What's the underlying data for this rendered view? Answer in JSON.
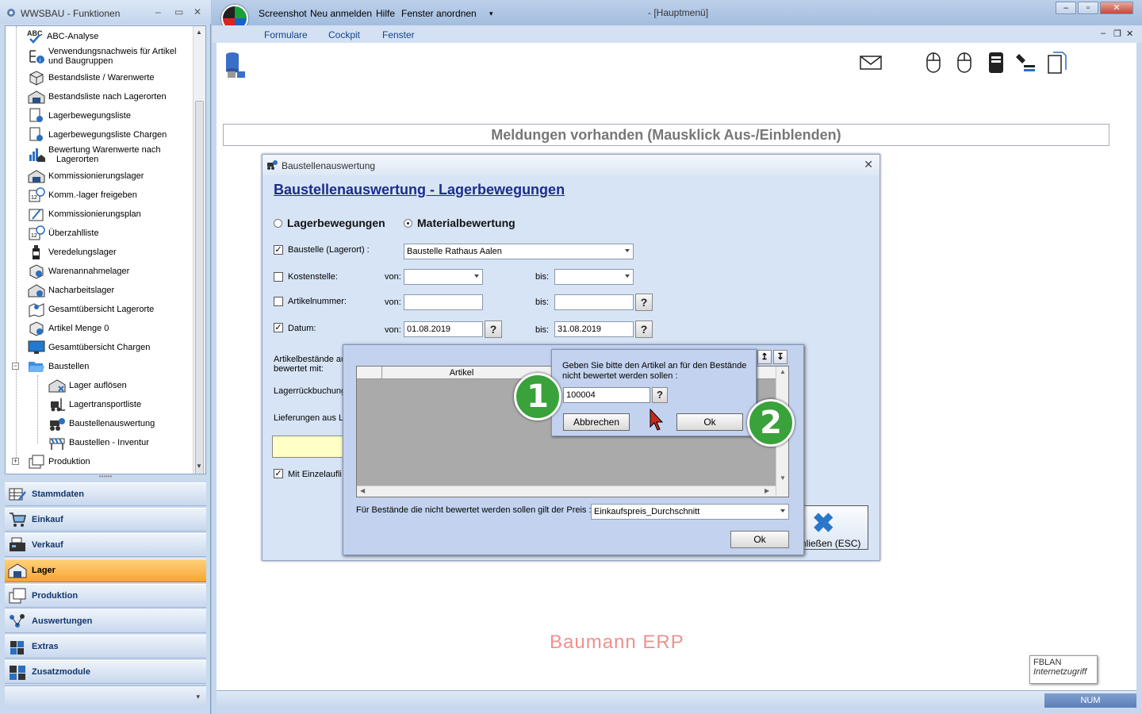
{
  "left_window": {
    "title": "WWSBAU - Funktionen",
    "tree_items": [
      {
        "label": "ABC-Analyse",
        "icon": "abc-check-icon"
      },
      {
        "label": "Verwendungsnachweis für Artikel",
        "label2": "und Baugruppen",
        "icon": "structure-info-icon"
      },
      {
        "label": "Bestandsliste / Warenwerte",
        "icon": "box-icon"
      },
      {
        "label": "Bestandsliste nach Lagerorten",
        "icon": "warehouse-icon"
      },
      {
        "label": "Lagerbewegungsliste",
        "icon": "document-gear-icon"
      },
      {
        "label": "Lagerbewegungsliste Chargen",
        "icon": "document-gear-icon"
      },
      {
        "label": "Bewertung Warenwerte nach",
        "label2": "Lagerorten",
        "icon": "chart-warehouse-icon"
      },
      {
        "label": "Kommissionierungslager",
        "icon": "warehouse-icon"
      },
      {
        "label": "Komm.-lager freigeben",
        "icon": "calendar-clock-icon"
      },
      {
        "label": "Kommissionierungsplan",
        "icon": "pencil-board-icon"
      },
      {
        "label": "Überzahlliste",
        "icon": "calendar-clock-icon"
      },
      {
        "label": "Veredelungslager",
        "icon": "bottle-icon"
      },
      {
        "label": "Warenannahmelager",
        "icon": "box-gear-icon"
      },
      {
        "label": "Nacharbeitslager",
        "icon": "warehouse-gear-icon"
      },
      {
        "label": "Gesamtübersicht Lagerorte",
        "icon": "map-pin-icon"
      },
      {
        "label": "Artikel Menge 0",
        "icon": "box-info-icon"
      },
      {
        "label": "Gesamtübersicht Chargen",
        "icon": "monitor-icon"
      },
      {
        "label": "Baustellen",
        "icon": "folder-open-icon"
      },
      {
        "label": "Lager auflösen",
        "icon": "warehouse-x-icon"
      },
      {
        "label": "Lagertransportliste",
        "icon": "forklift-icon"
      },
      {
        "label": "Baustellenauswertung",
        "icon": "vehicle-gear-icon"
      },
      {
        "label": "Baustellen - Inventur",
        "icon": "barrier-icon"
      },
      {
        "label": "Produktion",
        "icon": "machine-icon"
      }
    ],
    "nav_buttons": [
      {
        "label": "Stammdaten",
        "icon": "table-edit-icon",
        "active": false
      },
      {
        "label": "Einkauf",
        "icon": "shopping-cart-icon",
        "active": false
      },
      {
        "label": "Verkauf",
        "icon": "cash-register-icon",
        "active": false
      },
      {
        "label": "Lager",
        "icon": "warehouse-icon",
        "active": true
      },
      {
        "label": "Produktion",
        "icon": "machine-icon",
        "active": false
      },
      {
        "label": "Auswertungen",
        "icon": "network-icon",
        "active": false
      },
      {
        "label": "Extras",
        "icon": "puzzle-icon",
        "active": false
      },
      {
        "label": "Zusatzmodule",
        "icon": "modules-icon",
        "active": false
      }
    ]
  },
  "main_window": {
    "quick_access": [
      "Screenshot",
      "Neu anmelden",
      "Hilfe",
      "Fenster anordnen"
    ],
    "caption": "- [Hauptmenü]",
    "ribbon_tabs": [
      "Formulare",
      "Cockpit",
      "Fenster"
    ],
    "messages_bar": "Meldungen vorhanden  (Mausklick Aus-/Einblenden)",
    "watermark": "Baumann ERP",
    "tooltip": {
      "line1": "FBLAN",
      "line2": "Internetzugriff"
    },
    "status_num": "NUM"
  },
  "dialog": {
    "title": "Baustellenauswertung",
    "heading": "Baustellenauswertung - Lagerbewegungen",
    "radio_options": [
      {
        "label": "Lagerbewegungen",
        "selected": false
      },
      {
        "label": "Materialbewertung",
        "selected": true
      }
    ],
    "rows": {
      "baustelle": {
        "label": "Baustelle (Lagerort) :",
        "checked": true,
        "value": "Baustelle Rathaus Aalen"
      },
      "kostenstelle": {
        "label": "Kostenstelle:",
        "checked": false,
        "von_label": "von:",
        "bis_label": "bis:",
        "von": "",
        "bis": ""
      },
      "artikelnummer": {
        "label": "Artikelnummer:",
        "checked": false,
        "von_label": "von:",
        "bis_label": "bis:",
        "von": "",
        "bis": ""
      },
      "datum": {
        "label": "Datum:",
        "checked": true,
        "von_label": "von:",
        "bis_label": "bis:",
        "von": "01.08.2019",
        "bis": "31.08.2019"
      }
    },
    "label_artikelbestaende": "Artikelbestände au",
    "label_bewertet": "bewertet mit:",
    "label_lagerrueck": "Lagerrückbuchung",
    "label_lieferungen": "Lieferungen aus L",
    "label_einzelaufl": "Mit Einzelaufli",
    "einzelaufl_checked": true,
    "close_label": "hließen (ESC)"
  },
  "subdialog": {
    "grid_column": "Artikel",
    "preis_label": "Für Bestände die nicht bewertet werden sollen gilt  der Preis :",
    "preis_value": "Einkaufspreis_Durchschnitt",
    "ok_label": "Ok"
  },
  "prompt": {
    "message": "Geben Sie bitte den Artikel an für den Bestände nicht bewertet werden sollen :",
    "input_value": "100004",
    "cancel_label": "Abbrechen",
    "ok_label": "Ok",
    "help_label": "?"
  },
  "markers": [
    "1",
    "2"
  ],
  "colors": {
    "accent_orange": "#f7a536",
    "heading_blue": "#1b2d8a",
    "marker_green": "#3aa23a",
    "watermark": "#f09090"
  }
}
